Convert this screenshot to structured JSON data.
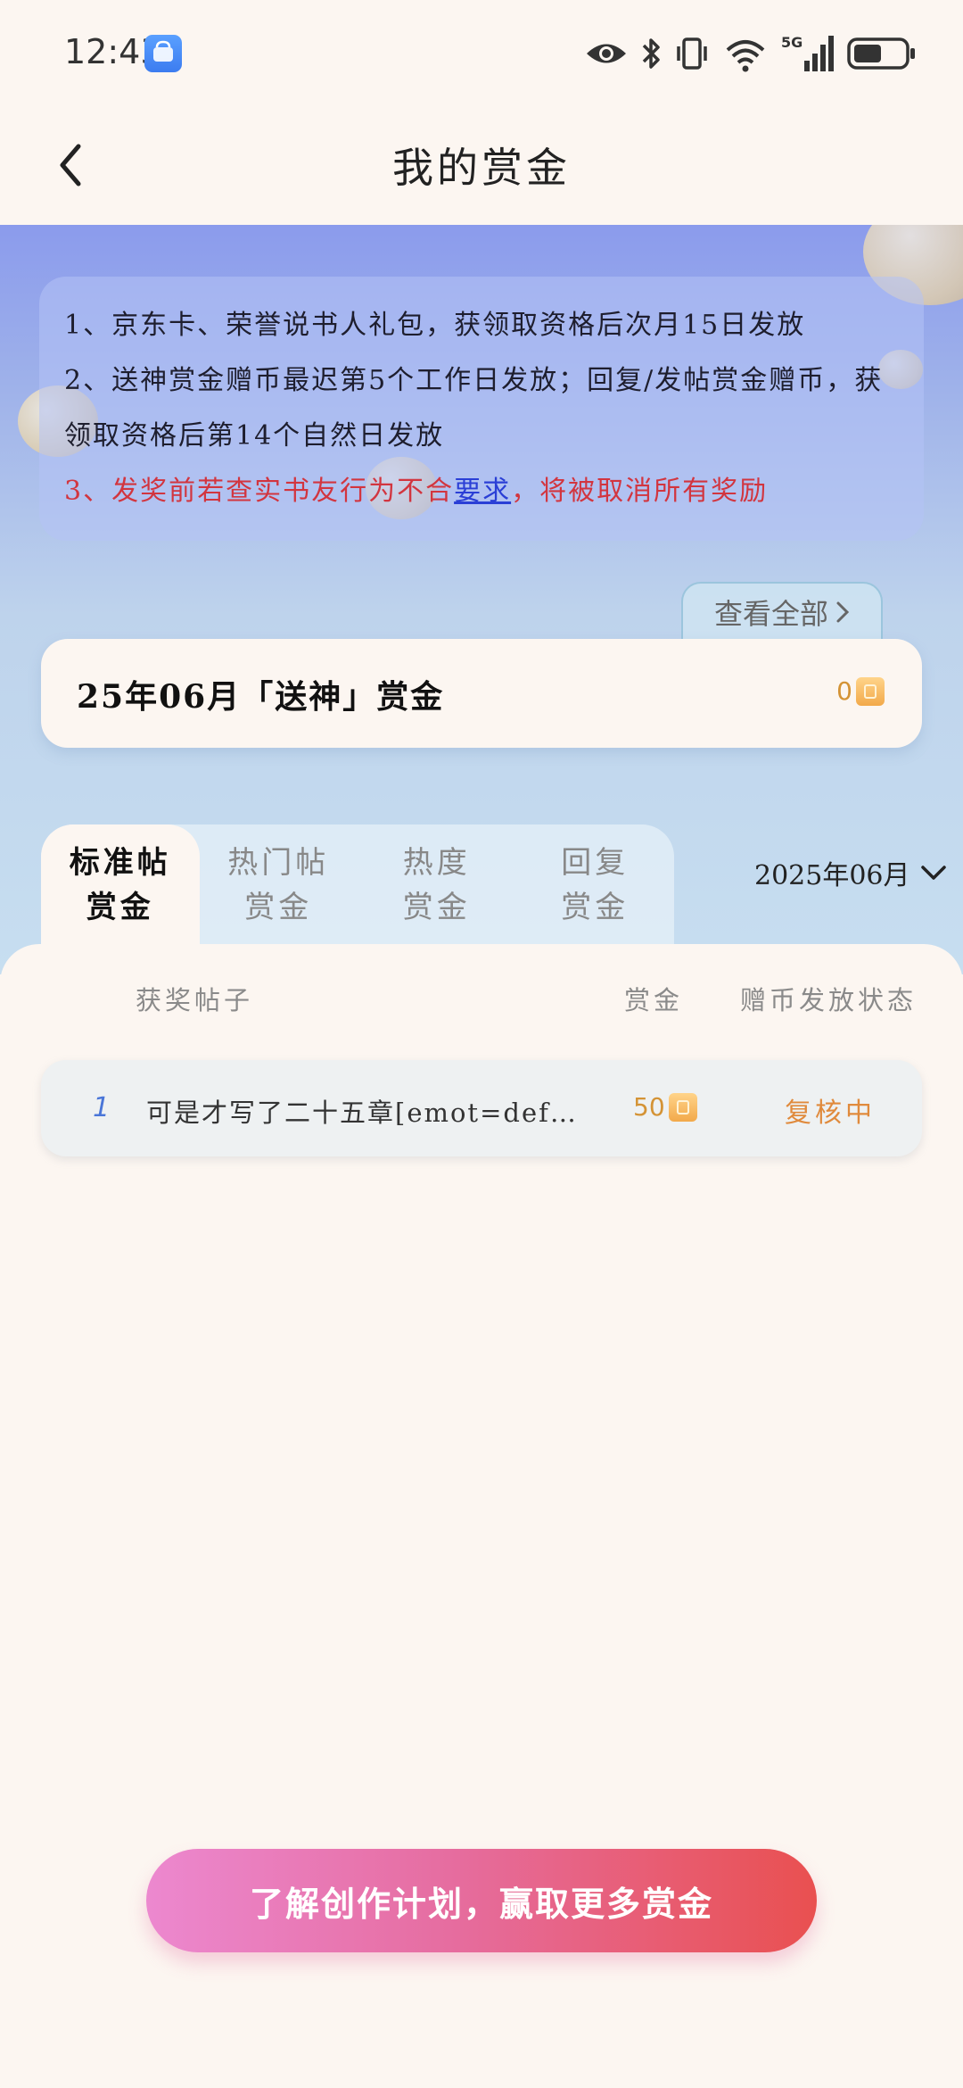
{
  "status_bar": {
    "time": "12:43",
    "network": "5G"
  },
  "header": {
    "title": "我的赏金"
  },
  "rules": [
    "1、京东卡、荣誉说书人礼包，获领取资格后次月15日发放",
    "2、送神赏金赠币最迟第5个工作日发放；回复/发帖赏金赠币，获领取资格后第14个自然日发放",
    {
      "before": "3、发奖前若查实书友行为不合",
      "link": "要求",
      "after": "，将被取消所有奖励"
    }
  ],
  "view_all": "查看全部",
  "bounty_card": {
    "title": "25年06月「送神」赏金",
    "amount": "0"
  },
  "tabs": [
    {
      "line1": "标准帖",
      "line2": "赏金",
      "active": true
    },
    {
      "line1": "热门帖",
      "line2": "赏金",
      "active": false
    },
    {
      "line1": "热度",
      "line2": "赏金",
      "active": false
    },
    {
      "line1": "回复",
      "line2": "赏金",
      "active": false
    }
  ],
  "month_selector": "2025年06月",
  "table": {
    "headers": {
      "post": "获奖帖子",
      "amount": "赏金",
      "status": "赠币发放状态"
    },
    "rows": [
      {
        "index": "1",
        "post": "可是才写了二十五章[emot=def…",
        "amount": "50",
        "status": "复核中"
      }
    ]
  },
  "cta_button": "了解创作计划，赢取更多赏金",
  "colors": {
    "accent_orange": "#d49335",
    "status_orange": "#e08a3c",
    "rule_red": "#d2353f",
    "link_blue": "#2a3fd6",
    "cta_start": "#ec88cf",
    "cta_end": "#e95050"
  }
}
